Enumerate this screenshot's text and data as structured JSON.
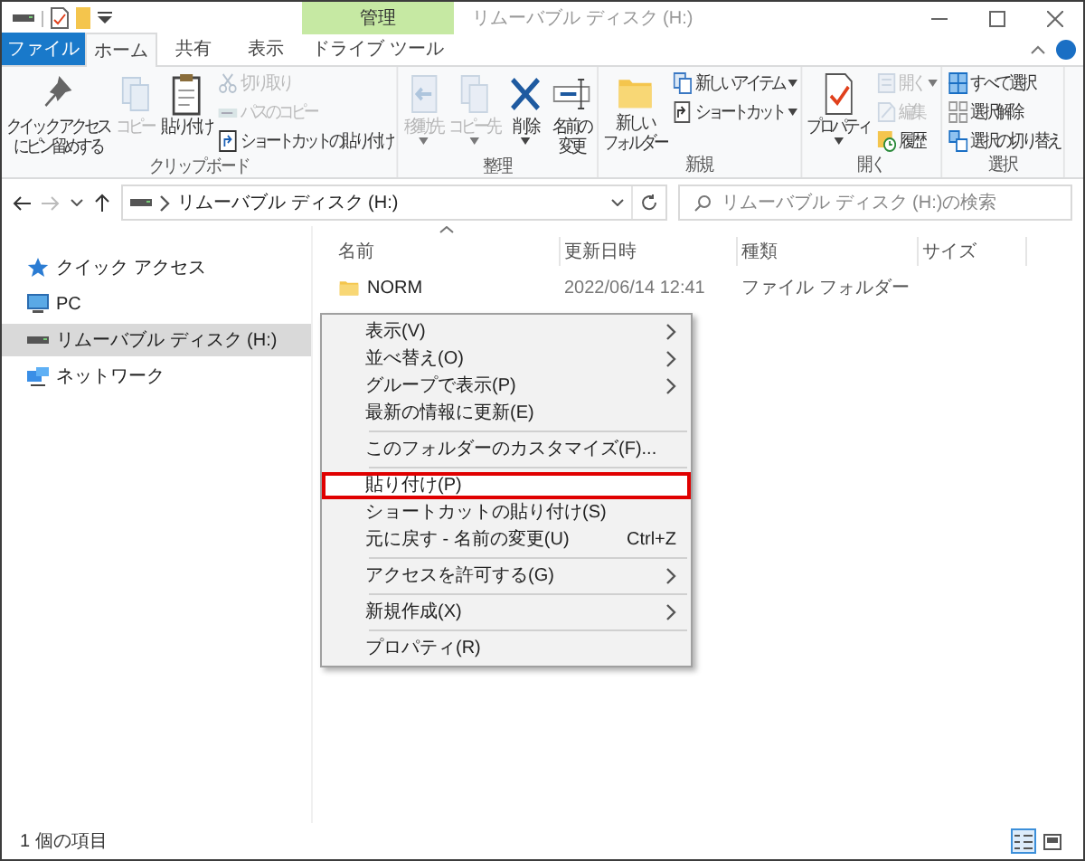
{
  "title_bar": {
    "context_tab": "管理",
    "title": "リムーバブル ディスク (H:)"
  },
  "tabs": [
    {
      "label": "ファイル",
      "kind": "file",
      "selected": false
    },
    {
      "label": "ホーム",
      "kind": "tab",
      "selected": true
    },
    {
      "label": "共有",
      "kind": "tab",
      "selected": false
    },
    {
      "label": "表示",
      "kind": "tab",
      "selected": false
    },
    {
      "label": "ドライブ ツール",
      "kind": "context",
      "selected": false
    }
  ],
  "ribbon": {
    "groups": [
      {
        "label": "クリップボード",
        "items": [
          {
            "kind": "large",
            "lines": [
              "クイック アクセス",
              "にピン留めする"
            ],
            "disabled": false,
            "dropdown": false
          },
          {
            "kind": "large",
            "lines": [
              "コピー"
            ],
            "disabled": true,
            "dropdown": false
          },
          {
            "kind": "large",
            "lines": [
              "貼り付け"
            ],
            "disabled": false,
            "dropdown": false
          },
          {
            "kind": "stack",
            "items": [
              {
                "label": "切り取り",
                "disabled": true,
                "dropdown": false
              },
              {
                "label": "パスのコピー",
                "disabled": true,
                "dropdown": false
              },
              {
                "label": "ショートカットの貼り付け",
                "disabled": false,
                "dropdown": false
              }
            ]
          }
        ]
      },
      {
        "label": "整理",
        "items": [
          {
            "kind": "large",
            "lines": [
              "移動先"
            ],
            "disabled": true,
            "dropdown": true
          },
          {
            "kind": "large",
            "lines": [
              "コピー先"
            ],
            "disabled": true,
            "dropdown": true
          },
          {
            "kind": "large",
            "lines": [
              "削除"
            ],
            "disabled": false,
            "dropdown": true
          },
          {
            "kind": "large",
            "lines": [
              "名前の",
              "変更"
            ],
            "disabled": false,
            "dropdown": false
          }
        ]
      },
      {
        "label": "新規",
        "items": [
          {
            "kind": "large",
            "lines": [
              "新しい",
              "フォルダー"
            ],
            "disabled": false,
            "dropdown": false
          },
          {
            "kind": "stack",
            "items": [
              {
                "label": "新しいアイテム",
                "disabled": false,
                "dropdown": true
              },
              {
                "label": "ショートカット",
                "disabled": false,
                "dropdown": true
              }
            ]
          }
        ]
      },
      {
        "label": "開く",
        "items": [
          {
            "kind": "large",
            "lines": [
              "プロパティ"
            ],
            "disabled": false,
            "dropdown": true
          },
          {
            "kind": "stack",
            "items": [
              {
                "label": "開く",
                "disabled": true,
                "dropdown": true
              },
              {
                "label": "編集",
                "disabled": true,
                "dropdown": false
              },
              {
                "label": "履歴",
                "disabled": false,
                "dropdown": false
              }
            ]
          }
        ]
      },
      {
        "label": "選択",
        "items": [
          {
            "kind": "stack",
            "items": [
              {
                "label": "すべて選択",
                "disabled": false,
                "dropdown": false
              },
              {
                "label": "選択解除",
                "disabled": false,
                "dropdown": false
              },
              {
                "label": "選択の切り替え",
                "disabled": false,
                "dropdown": false
              }
            ]
          }
        ]
      }
    ]
  },
  "address_bar": {
    "path": "リムーバブル ディスク (H:)",
    "search_placeholder": "リムーバブル ディスク (H:)の検索"
  },
  "navigation": [
    {
      "label": "クイック アクセス",
      "selected": false
    },
    {
      "label": "PC",
      "selected": false
    },
    {
      "label": "リムーバブル ディスク (H:)",
      "selected": true
    },
    {
      "label": "ネットワーク",
      "selected": false
    }
  ],
  "file_list": {
    "columns": [
      "名前",
      "更新日時",
      "種類",
      "サイズ"
    ],
    "rows": [
      {
        "name": "NORM",
        "modified": "2022/06/14 12:41",
        "type": "ファイル フォルダー"
      }
    ]
  },
  "context_menu": {
    "items": [
      {
        "kind": "item",
        "label": "表示(V)",
        "submenu": true,
        "highlighted": false
      },
      {
        "kind": "item",
        "label": "並べ替え(O)",
        "submenu": true,
        "highlighted": false
      },
      {
        "kind": "item",
        "label": "グループで表示(P)",
        "submenu": true,
        "highlighted": false
      },
      {
        "kind": "item",
        "label": "最新の情報に更新(E)",
        "submenu": false,
        "highlighted": false
      },
      {
        "kind": "separator"
      },
      {
        "kind": "item",
        "label": "このフォルダーのカスタマイズ(F)...",
        "submenu": false,
        "highlighted": false
      },
      {
        "kind": "separator"
      },
      {
        "kind": "item",
        "label": "貼り付け(P)",
        "submenu": false,
        "highlighted": true
      },
      {
        "kind": "item",
        "label": "ショートカットの貼り付け(S)",
        "submenu": false,
        "highlighted": false
      },
      {
        "kind": "item",
        "label": "元に戻す - 名前の変更(U)",
        "shortcut": "Ctrl+Z",
        "submenu": false,
        "highlighted": false
      },
      {
        "kind": "separator"
      },
      {
        "kind": "item",
        "label": "アクセスを許可する(G)",
        "submenu": true,
        "highlighted": false
      },
      {
        "kind": "separator"
      },
      {
        "kind": "item",
        "label": "新規作成(X)",
        "submenu": true,
        "highlighted": false
      },
      {
        "kind": "separator"
      },
      {
        "kind": "item",
        "label": "プロパティ(R)",
        "submenu": false,
        "highlighted": false
      }
    ]
  },
  "status_bar": {
    "text": "1 個の項目",
    "views": [
      {
        "selected": true
      },
      {
        "selected": false
      }
    ]
  }
}
